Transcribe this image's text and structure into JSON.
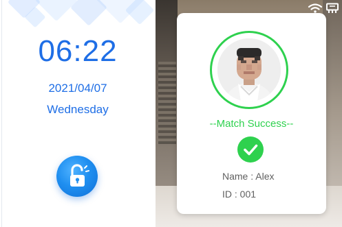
{
  "clock": {
    "time": "06:22",
    "date": "2021/04/07",
    "weekday": "Wednesday"
  },
  "unlock_button": {
    "icon": "unlock-icon"
  },
  "status_bar": {
    "icons": [
      "wifi-icon",
      "network-icon"
    ]
  },
  "match": {
    "title": "--Match Success--",
    "name_label": "Name : Alex",
    "id_label": "ID : 001",
    "icons": {
      "avatar": "face-avatar",
      "status": "check-icon"
    }
  },
  "colors": {
    "accent_blue": "#1e6ee6",
    "success_green": "#2ed14e",
    "text_gray": "#5f5f5f",
    "card_bg": "#ffffff"
  }
}
